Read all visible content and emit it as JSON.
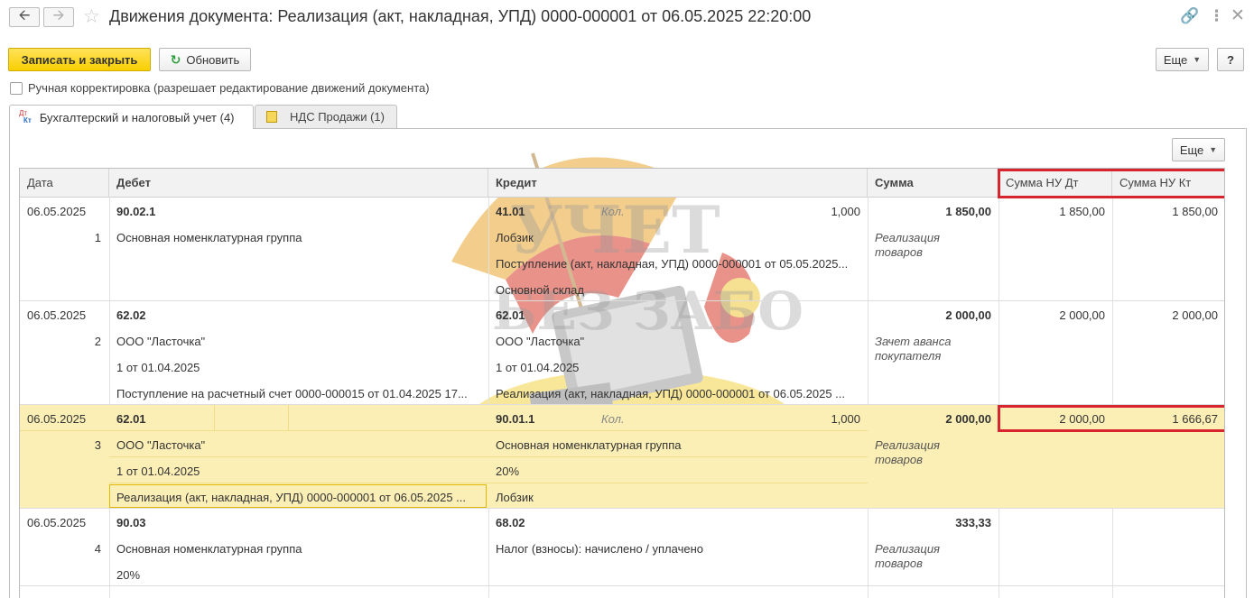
{
  "window": {
    "title": "Движения документа: Реализация (акт, накладная, УПД) 0000-000001 от 06.05.2025 22:20:00",
    "icons": [
      "arrow-left-icon",
      "arrow-right-icon",
      "star-icon",
      "link-icon",
      "more-vert-icon",
      "close-icon"
    ]
  },
  "toolbar": {
    "save_close": "Записать и закрыть",
    "refresh": "Обновить",
    "more": "Еще",
    "help": "?"
  },
  "manual_correction": {
    "label": "Ручная корректировка (разрешает редактирование движений документа)",
    "checked": false
  },
  "tabs": [
    {
      "label": "Бухгалтерский и налоговый учет (4)",
      "icon": "dt-kt-icon",
      "active": true
    },
    {
      "label": "НДС Продажи (1)",
      "icon": "register-icon",
      "active": false
    }
  ],
  "panel": {
    "more": "Еще"
  },
  "grid": {
    "columns": [
      "Дата",
      "Дебет",
      "Кредит",
      "Сумма",
      "Сумма НУ Дт",
      "Сумма НУ Кт"
    ],
    "rows": [
      {
        "date": "06.05.2025",
        "num": "1",
        "debit": [
          "90.02.1",
          "Основная номенклатурная группа",
          "",
          ""
        ],
        "credit": [
          "41.01",
          "Лобзик",
          "Поступление (акт, накладная, УПД) 0000-000001 от 05.05.2025...",
          "Основной склад"
        ],
        "kol_label": "Кол.",
        "kol_value": "1,000",
        "sum": "1 850,00",
        "content": "Реализация товаров",
        "nu_dt": "1 850,00",
        "nu_kt": "1 850,00"
      },
      {
        "date": "06.05.2025",
        "num": "2",
        "debit": [
          "62.02",
          "ООО \"Ласточка\"",
          "1 от 01.04.2025",
          "Поступление на расчетный счет 0000-000015 от 01.04.2025 17..."
        ],
        "credit": [
          "62.01",
          "ООО \"Ласточка\"",
          "1 от 01.04.2025",
          "Реализация (акт, накладная, УПД) 0000-000001 от 06.05.2025 ..."
        ],
        "kol_label": "",
        "kol_value": "",
        "sum": "2 000,00",
        "content": "Зачет аванса покупателя",
        "nu_dt": "2 000,00",
        "nu_kt": "2 000,00"
      },
      {
        "date": "06.05.2025",
        "num": "3",
        "debit": [
          "62.01",
          "ООО \"Ласточка\"",
          "1 от 01.04.2025",
          "Реализация (акт, накладная, УПД) 0000-000001 от 06.05.2025 ..."
        ],
        "credit": [
          "90.01.1",
          "Основная номенклатурная группа",
          "20%",
          "Лобзик"
        ],
        "kol_label": "Кол.",
        "kol_value": "1,000",
        "sum": "2 000,00",
        "content": "Реализация товаров",
        "nu_dt": "2 000,00",
        "nu_kt": "1 666,67",
        "selected": true
      },
      {
        "date": "06.05.2025",
        "num": "4",
        "debit": [
          "90.03",
          "Основная номенклатурная группа",
          "20%",
          ""
        ],
        "credit": [
          "68.02",
          "Налог (взносы): начислено / уплачено",
          "",
          ""
        ],
        "kol_label": "",
        "kol_value": "",
        "sum": "333,33",
        "content": "Реализация товаров",
        "nu_dt": "",
        "nu_kt": ""
      }
    ]
  },
  "watermark": {
    "line1": "УЧЕТ",
    "line2": "БЕЗ ЗАБОТ"
  },
  "colors": {
    "accent_yellow": "#f9cf00",
    "selected_row": "#fbefb6",
    "highlight_red": "#d8242e"
  }
}
